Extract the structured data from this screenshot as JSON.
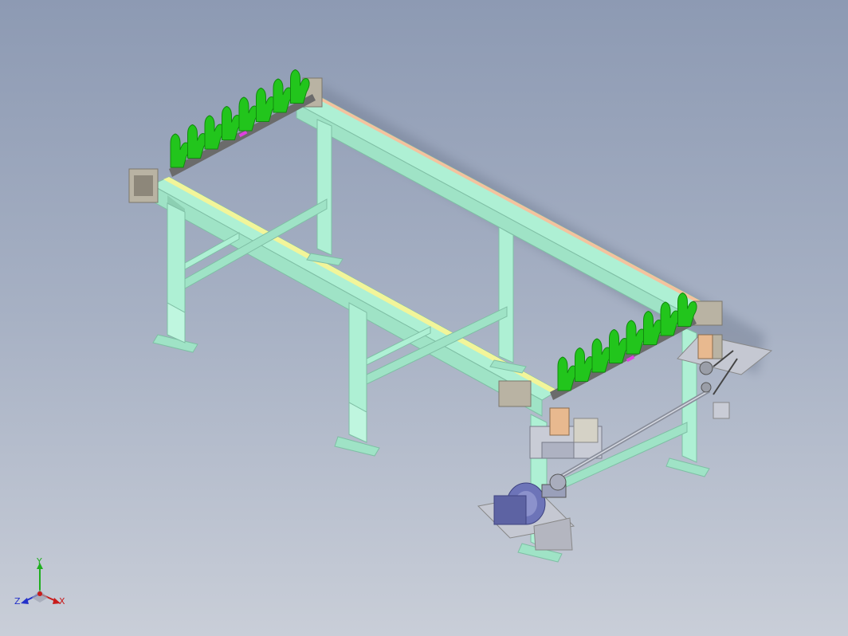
{
  "viewport": {
    "background_top": "#8d9ab3",
    "background_bottom": "#c9ced8"
  },
  "model": {
    "frame_color": "#aef0d4",
    "frame_shadow": "#8ccfb2",
    "rail_stripe_color": "#f2f59a",
    "rail_stripe_back_color": "#f4c29e",
    "finger_color": "#22c51c",
    "marker_color": "#e040e0",
    "motor_color": "#6d74b8"
  },
  "triad": {
    "y_label": "Y",
    "z_label": "Z",
    "x_label": "X",
    "y_color": "#1fae1f",
    "z_color": "#2431c9",
    "x_color": "#c81b1b"
  }
}
